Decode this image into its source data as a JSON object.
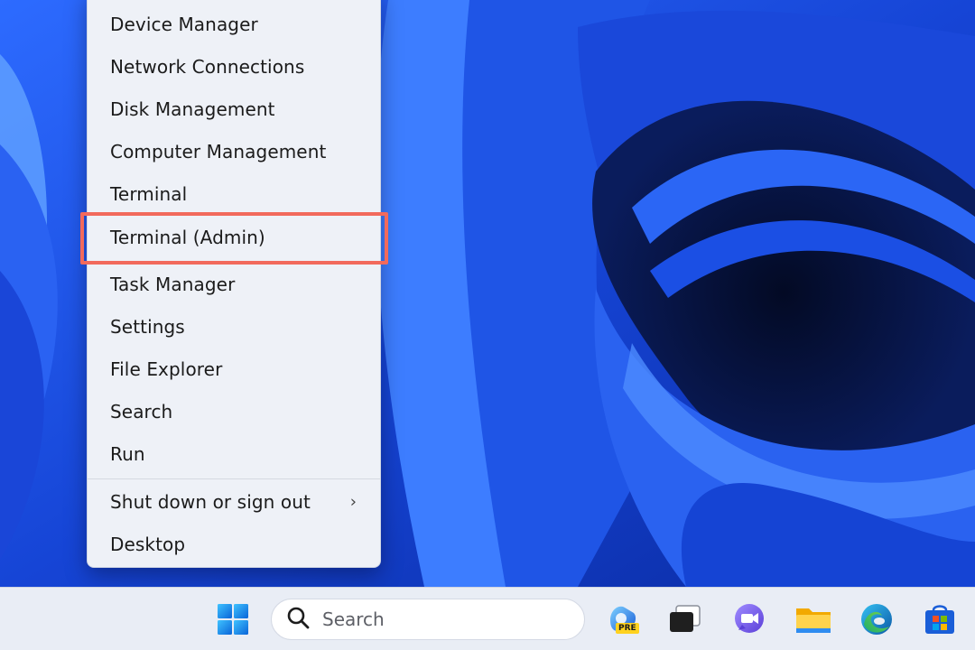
{
  "menu": {
    "items": [
      {
        "label": "Device Manager"
      },
      {
        "label": "Network Connections"
      },
      {
        "label": "Disk Management"
      },
      {
        "label": "Computer Management"
      },
      {
        "label": "Terminal"
      },
      {
        "label": "Terminal (Admin)"
      },
      {
        "label": "Task Manager"
      },
      {
        "label": "Settings"
      },
      {
        "label": "File Explorer"
      },
      {
        "label": "Search"
      },
      {
        "label": "Run"
      },
      {
        "label": "Shut down or sign out",
        "submenu_icon": "chevron-right-icon"
      },
      {
        "label": "Desktop"
      }
    ],
    "highlighted_item": "Terminal (Admin)",
    "highlight_color": "#f26a5c"
  },
  "taskbar": {
    "search_placeholder": "Search",
    "pinned_icons": [
      "windows-start-icon",
      "search-icon",
      "copilot-pre-icon",
      "task-view-icon",
      "teams-chat-icon",
      "file-explorer-icon",
      "edge-icon",
      "microsoft-store-icon"
    ],
    "copilot_badge": "PRE"
  },
  "colors": {
    "wallpaper_blue": "#1a4fe0",
    "wallpaper_dark": "#06122f",
    "taskbar_bg": "#e9edf5",
    "menu_bg": "#eef1f7"
  }
}
